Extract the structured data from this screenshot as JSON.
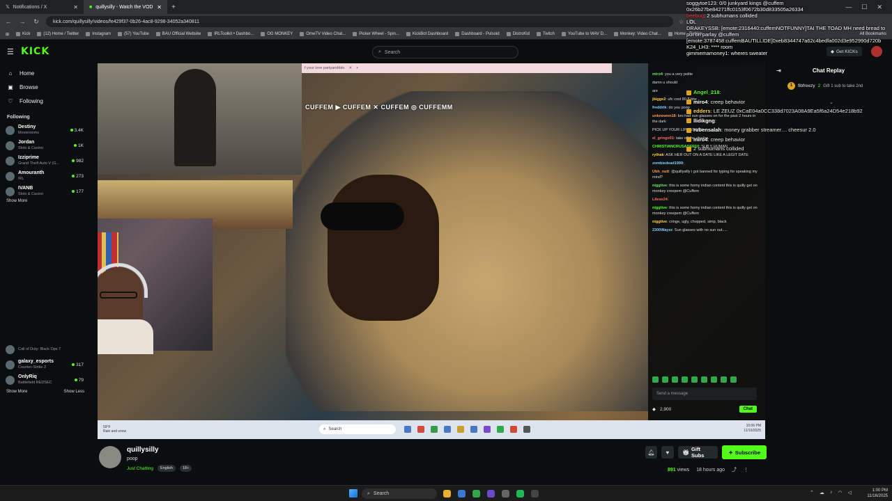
{
  "browser": {
    "tabs": [
      {
        "label": "Notifications / X"
      },
      {
        "label": "quillysilly - Watch the VOD"
      }
    ],
    "url": "kick.com/quillysilly/videos/fe429f37-0b26-4ac8-9298-34052a340811",
    "bookmarks": [
      "Kick",
      "(12) Home / Twitter",
      "Instagram",
      "(57) YouTube",
      "BAU Official Website",
      "IRLToolkit • Dashbo...",
      "OG MONKEY",
      "OmeTV Video Chat...",
      "Picker Wheel - Spin...",
      "KickBot Dashboard",
      "Dashboard - Pulsoid",
      "DistroKid",
      "Twitch",
      "YouTube to WAV D...",
      "Monkey: Video Chat...",
      "Home - Roblox"
    ],
    "all_bookmarks": "All Bookmarks"
  },
  "header": {
    "logo": "KICK",
    "search_placeholder": "Search",
    "get_kicks": "Get KICKs"
  },
  "sidebar": {
    "nav": [
      {
        "label": "Home",
        "icon": "home-icon"
      },
      {
        "label": "Browse",
        "icon": "browse-icon"
      },
      {
        "label": "Following",
        "icon": "heart-icon"
      }
    ],
    "following_title": "Following",
    "channels": [
      {
        "name": "Destiny",
        "category": "Movierooms",
        "viewers": "3.4K"
      },
      {
        "name": "Jordan",
        "category": "Slots & Casino",
        "viewers": "1K"
      },
      {
        "name": "Izziprime",
        "category": "Grand Theft Auto V (G...",
        "viewers": "982"
      },
      {
        "name": "Amouranth",
        "category": "IRL",
        "viewers": "273"
      },
      {
        "name": "IVANB",
        "category": "Slots & Casino",
        "viewers": "177"
      }
    ],
    "show_more": "Show More",
    "channels_lower": [
      {
        "name": "",
        "category": "Call of Duty: Black Ops 7",
        "viewers": ""
      },
      {
        "name": "galaxy_esports",
        "category": "Counter-Strike 2",
        "viewers": "317"
      },
      {
        "name": "OnlyRiq",
        "category": "Battlefield REDSEC",
        "viewers": "79"
      }
    ],
    "footer_more": "Show More",
    "footer_less": "Show Less"
  },
  "video": {
    "cuffem_text": "CUFFEM ▶ CUFFEM ✕ CUFFEM ◎ CUFFEMM",
    "inner_tab": "f your love partyandddo",
    "inner_chat": [
      {
        "user": "miro4",
        "text": "you a very polite"
      },
      {
        "user": "",
        "text": "damn u should"
      },
      {
        "user": "",
        "text": "are"
      },
      {
        "user": "jbigge2",
        "text": "ufc cost 80 $ btw"
      },
      {
        "user": "freddrik",
        "text": "do you poop"
      },
      {
        "user": "unknownn18",
        "text": "bro had sun glasses on for the past 2 hours in the dark"
      },
      {
        "user": "",
        "text": "PICK UP YOUR LIP FATMAN"
      },
      {
        "user": "el_gringo01",
        "text": "take off the shades"
      },
      {
        "user": "CHRISTIANCRUSADER10",
        "text": "SUB 5 HUMAN"
      },
      {
        "user": "rythak",
        "text": "ASK HER OUT ON A DATE LIKE A LEGIT DATE"
      },
      {
        "user": "zombiedead1999",
        "text": ""
      },
      {
        "user": "Ubh_nutt",
        "text": "@quillysilly i got banned for typing for speaking my mind?"
      },
      {
        "user": "niggtive",
        "text": "this is some horny indian content this is quilly get on monkey creepem @Cuffem"
      },
      {
        "user": "Lilese24",
        "text": ""
      },
      {
        "user": "niggtive",
        "text": "this is some horny indian content this is quilly get on monkey creepem @Cuffem"
      },
      {
        "user": "niggtive",
        "text": "cringe, ugly, chopped, simp, black"
      },
      {
        "user": "2300Wayzz",
        "text": "Sun glasses with no sun out....."
      }
    ],
    "inner_input_placeholder": "Send a message",
    "inner_points": "2,900",
    "inner_chat_btn": "Chat",
    "taskbar_weather_temp": "59°F",
    "taskbar_weather": "Rain and snow",
    "taskbar_search": "Search",
    "taskbar_time": "10:06 PM",
    "taskbar_date": "11/15/2025"
  },
  "overlay": [
    {
      "user": "soggytoe123",
      "text": "0/0 junkyard kings @cuffem 0x26b27be84271ffc0153f0672b30d833505a26334"
    },
    {
      "user": "beebug",
      "text": "2 subhumans collided"
    },
    {
      "user": "",
      "text": "LOL"
    },
    {
      "user": "DRAKEYSSB",
      "text": "[emote:2316440:cuffemNOTFUNNY]TAI THE TOAD MH need bread to put on parlay @cuffem"
    },
    {
      "user": "",
      "text": "[emote:3787458:cuffemBAUTILLIDE]0xeb8344747a62c4bedfa002d3e952990d720b"
    },
    {
      "user": "K24_LH3",
      "text": "**** room"
    },
    {
      "user": "gimmemamoney1",
      "text": "wheres sweater"
    }
  ],
  "chat_replay": {
    "title": "Chat Replay",
    "pinned_user": "fibfreezy",
    "pinned_count": "2",
    "pinned_text": "Gift 1 sub to take 2nd",
    "messages": [
      {
        "user": "Angel_218",
        "text": "",
        "color": "#53fc18"
      },
      {
        "user": "miro4",
        "text": "creep behavior",
        "color": "#ffffff"
      },
      {
        "user": "edders",
        "text": "LE ZEUZ 0xCaE04a0CC338d7023A08A9Ea5f6a24D54e218b92",
        "color": "#ffd23f"
      },
      {
        "user": "llidikgng",
        "text": "",
        "color": "#ffffff"
      },
      {
        "user": "rubensalah",
        "text": "money grabber streamer.... cheesur 2.0",
        "color": "#ffffff"
      },
      {
        "user": "miro4",
        "text": "creep behavior",
        "color": "#ffffff"
      },
      {
        "user": "",
        "text": "2 subhumans collided",
        "color": "#ffffff"
      }
    ]
  },
  "channel": {
    "name": "quillysilly",
    "title": "poop",
    "category": "Just Chatting",
    "tags": [
      "English",
      "18+"
    ],
    "gift_subs": "Gift Subs",
    "subscribe": "Subscribe",
    "views_count": "891",
    "views_label": "views",
    "ago": "18 hours ago"
  },
  "taskbar": {
    "search": "Search",
    "time": "1:00 PM",
    "date": "11/16/2025"
  },
  "colors": {
    "kick_green": "#53fc18",
    "background": "#0b0e0f"
  }
}
